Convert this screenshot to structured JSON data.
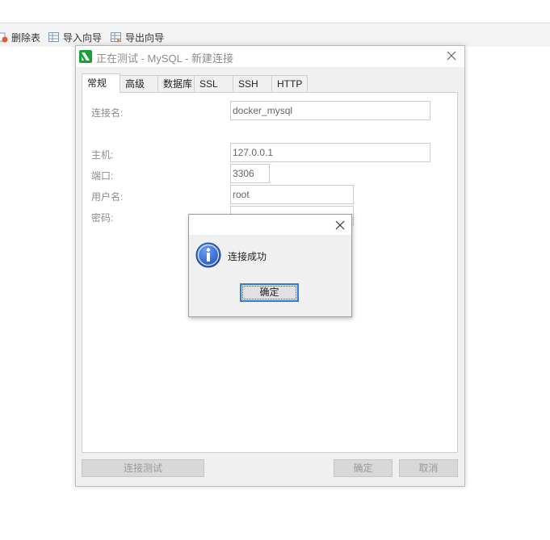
{
  "toolbar": {
    "delete_table": "删除表",
    "import_wizard": "导入向导",
    "export_wizard": "导出向导"
  },
  "dialog": {
    "title": "正在测试 - MySQL - 新建连接",
    "tabs": [
      "常规",
      "高级",
      "数据库",
      "SSL",
      "SSH",
      "HTTP"
    ],
    "labels": {
      "connection_name": "连接名:",
      "host": "主机:",
      "port": "端口:",
      "username": "用户名:",
      "password": "密码:"
    },
    "values": {
      "connection_name": "docker_mysql",
      "host": "127.0.0.1",
      "port": "3306",
      "username": "root",
      "password": "••••"
    },
    "buttons": {
      "test": "连接测试",
      "ok": "确定",
      "cancel": "取消"
    }
  },
  "alert": {
    "message": "连接成功",
    "ok": "确定"
  },
  "colors": {
    "accent": "#2f7bd5",
    "navicat_green": "#1a9f3a",
    "info_blue": "#1c4fb4"
  }
}
